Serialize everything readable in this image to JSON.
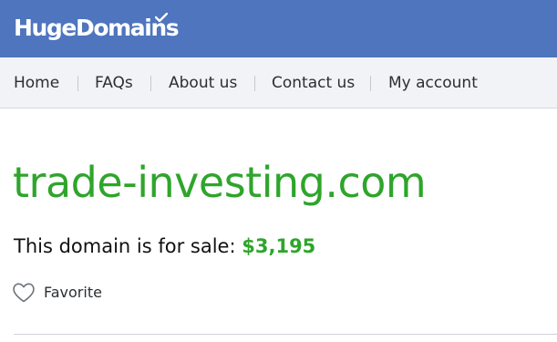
{
  "header": {
    "logo_text": "HugeDomains",
    "brand_color": "#4e75bd"
  },
  "nav": {
    "items": [
      {
        "label": "Home"
      },
      {
        "label": "FAQs"
      },
      {
        "label": "About us"
      },
      {
        "label": "Contact us"
      },
      {
        "label": "My account"
      }
    ]
  },
  "main": {
    "domain": "trade-investing.com",
    "sale_text": "This domain is for sale:",
    "price": "$3,195",
    "accent_color": "#2ea52b",
    "favorite_label": "Favorite",
    "favorite_icon": "heart-outline-icon"
  }
}
